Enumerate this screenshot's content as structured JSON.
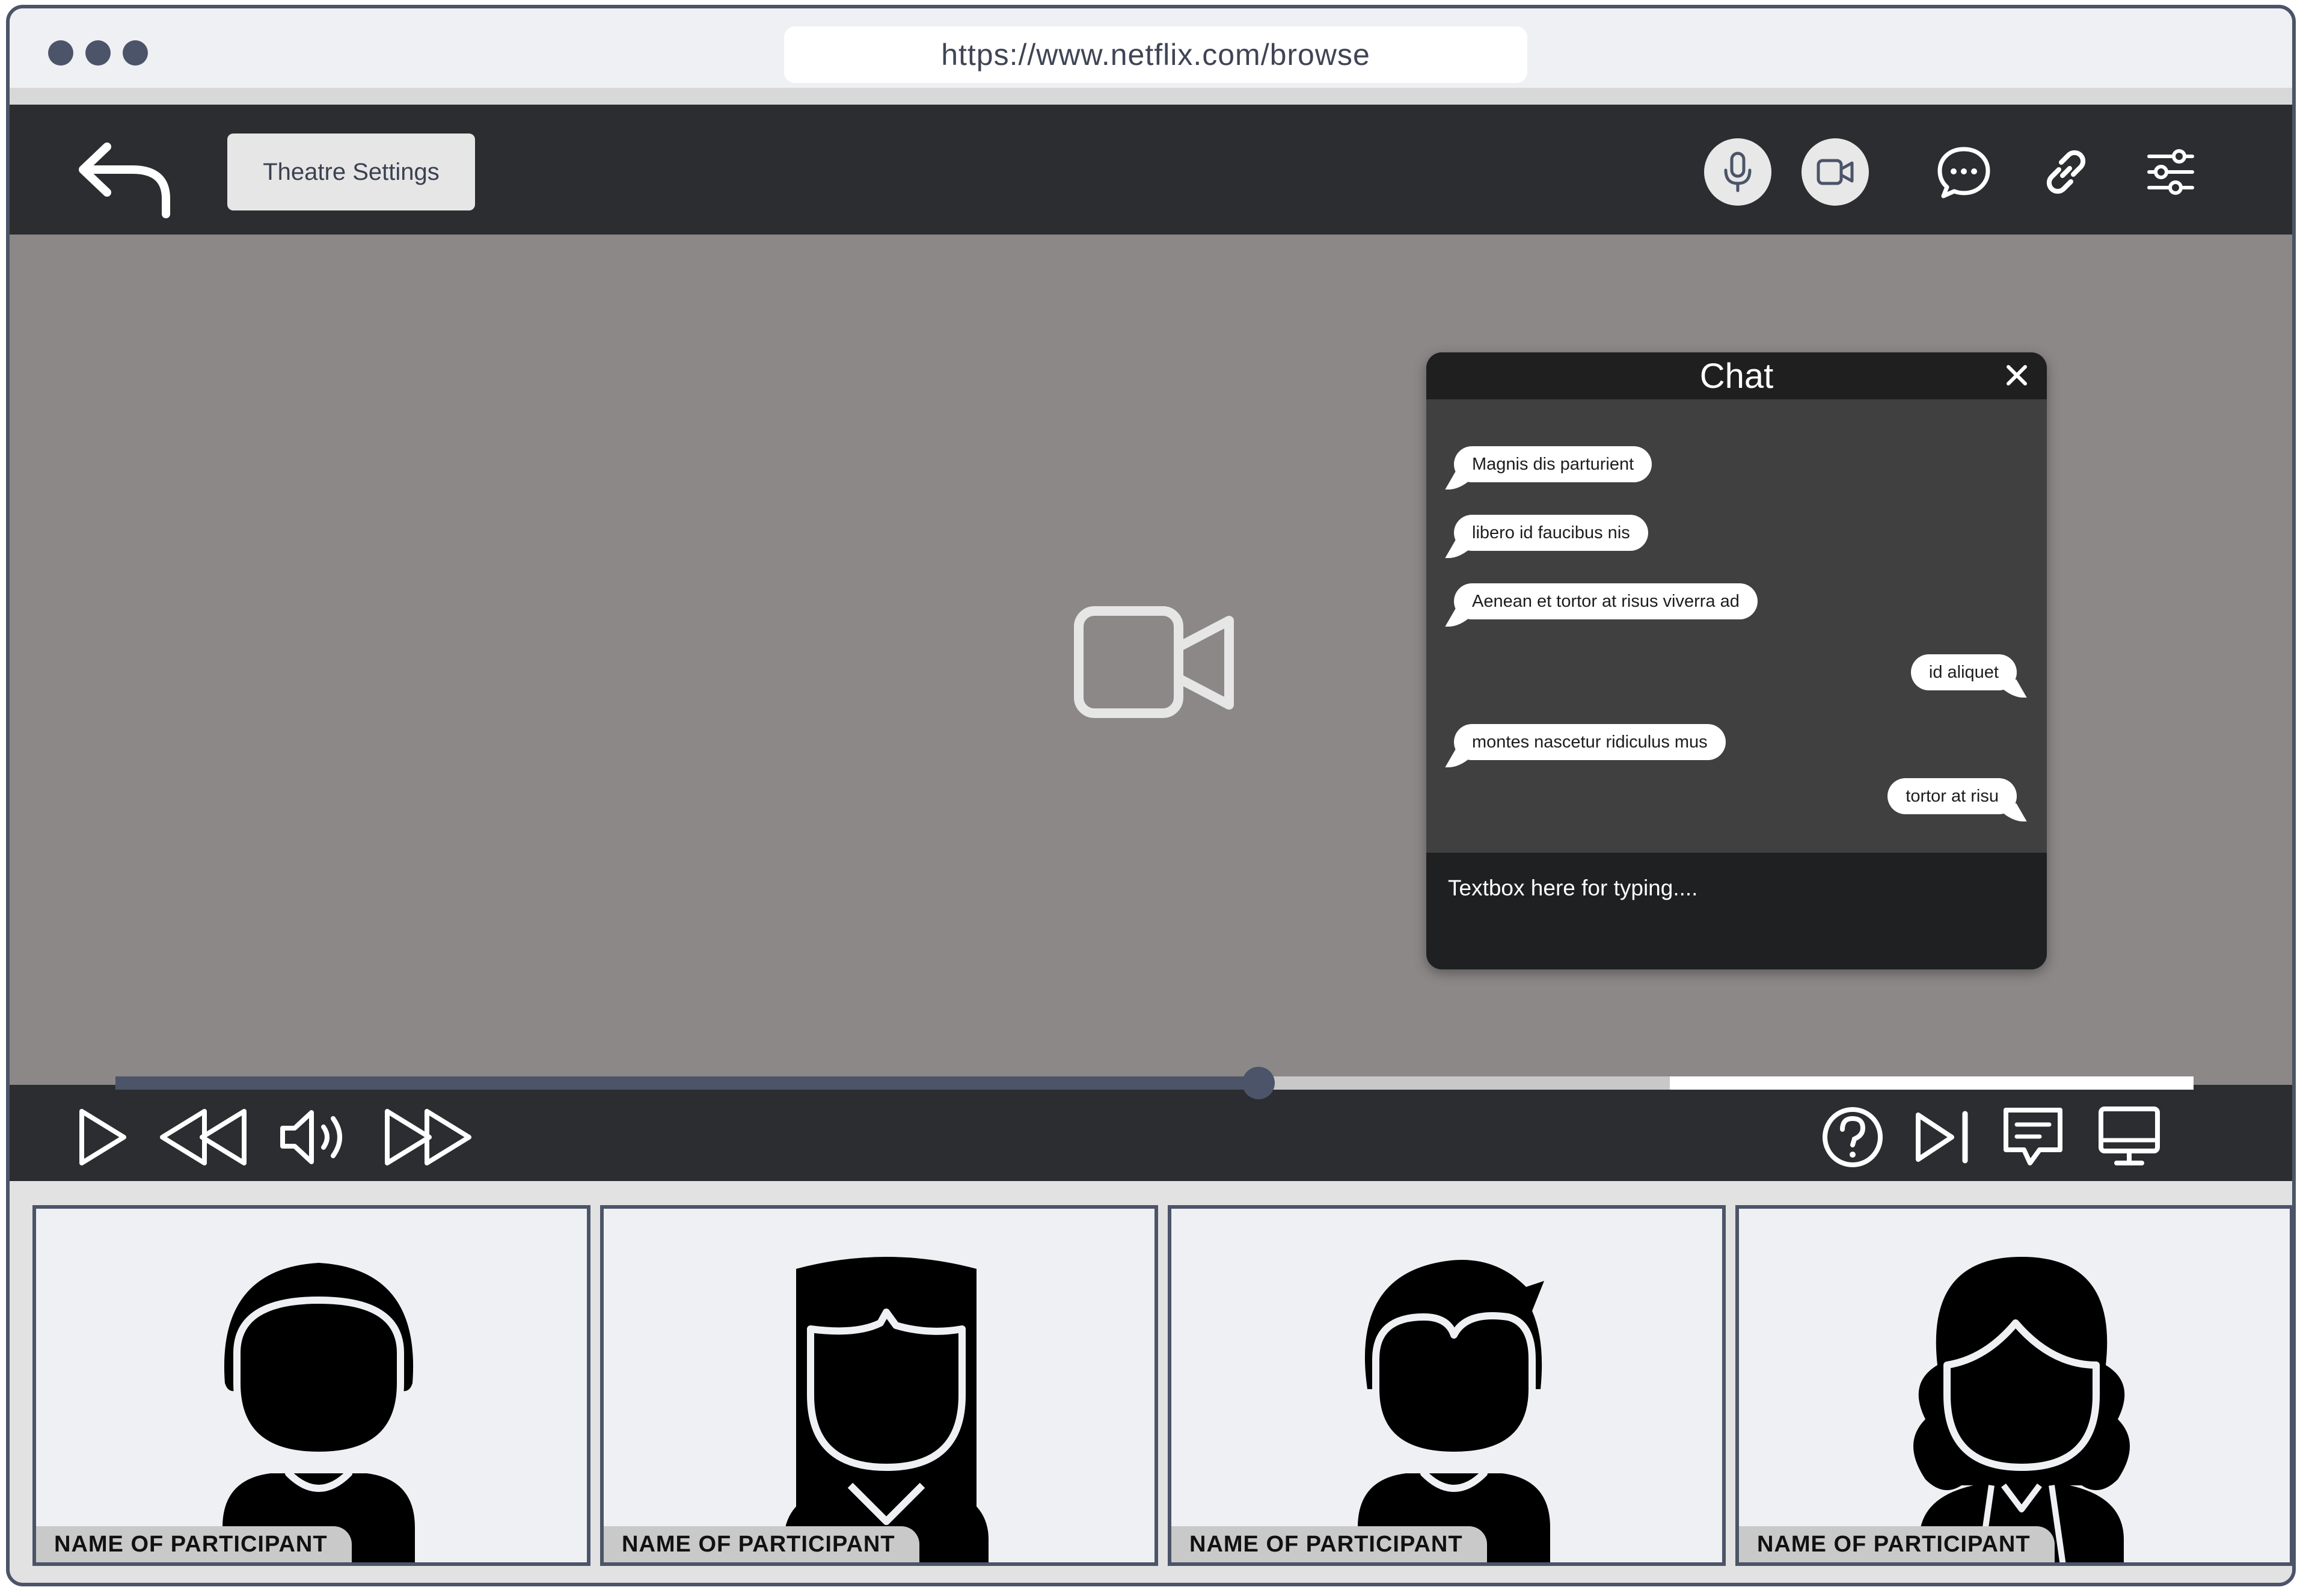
{
  "browser": {
    "url": "https://www.netflix.com/browse"
  },
  "toolbar": {
    "theatre_settings_label": "Theatre Settings",
    "icons": [
      "back-arrow-icon",
      "microphone-icon",
      "video-camera-icon",
      "chat-icon",
      "link-icon",
      "settings-sliders-icon"
    ]
  },
  "chat": {
    "title": "Chat",
    "messages": [
      {
        "text": "Magnis dis parturient",
        "side": "left"
      },
      {
        "text": "libero id faucibus nis",
        "side": "left"
      },
      {
        "text": "Aenean et tortor at risus viverra ad",
        "side": "left"
      },
      {
        "text": "id aliquet",
        "side": "right"
      },
      {
        "text": "montes nascetur ridiculus mus",
        "side": "left"
      },
      {
        "text": "tortor at risu",
        "side": "right"
      }
    ],
    "input_placeholder": "Textbox here for typing...."
  },
  "player": {
    "progress": 0.55,
    "buffered_start": 0.748,
    "controls": [
      "play-icon",
      "rewind-icon",
      "volume-icon",
      "fast-forward-icon",
      "help-icon",
      "skip-next-icon",
      "subtitles-icon",
      "screen-icon"
    ]
  },
  "participants": [
    {
      "name": "NAME OF PARTICIPANT"
    },
    {
      "name": "NAME OF PARTICIPANT"
    },
    {
      "name": "NAME OF PARTICIPANT"
    },
    {
      "name": "NAME OF PARTICIPANT"
    }
  ],
  "colors": {
    "accent": "#4b5468",
    "bar": "#2c2d30",
    "video": "#8c8888",
    "chat_bg": "#404040"
  }
}
